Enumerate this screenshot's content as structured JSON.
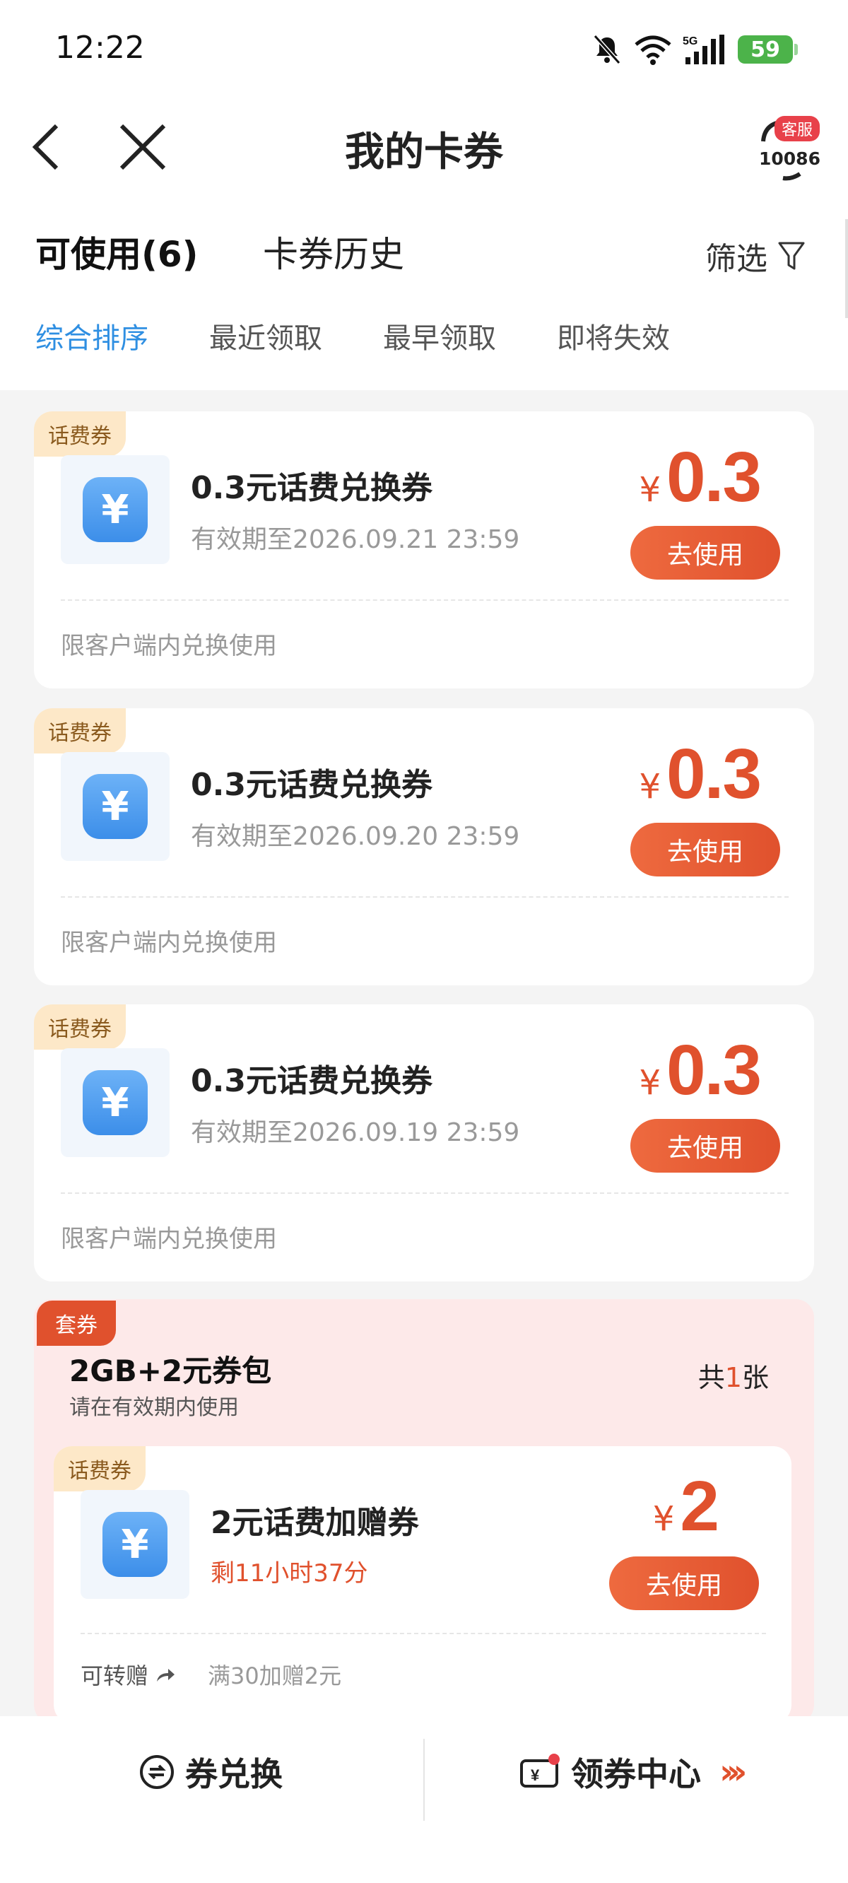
{
  "status_bar": {
    "time": "12:22",
    "network": "5G",
    "battery": "59"
  },
  "nav": {
    "title": "我的卡券",
    "service_badge": "客服",
    "service_number": "10086"
  },
  "tabs": {
    "available": "可使用(6)",
    "history": "卡券历史",
    "filter": "筛选"
  },
  "sorts": [
    "综合排序",
    "最近领取",
    "最早领取",
    "即将失效"
  ],
  "coupons": [
    {
      "tag": "话费券",
      "name": "0.3元话费兑换券",
      "expiry": "有效期至2026.09.21 23:59",
      "currency": "¥",
      "amount": "0.3",
      "button": "去使用",
      "note": "限客户端内兑换使用"
    },
    {
      "tag": "话费券",
      "name": "0.3元话费兑换券",
      "expiry": "有效期至2026.09.20 23:59",
      "currency": "¥",
      "amount": "0.3",
      "button": "去使用",
      "note": "限客户端内兑换使用"
    },
    {
      "tag": "话费券",
      "name": "0.3元话费兑换券",
      "expiry": "有效期至2026.09.19 23:59",
      "currency": "¥",
      "amount": "0.3",
      "button": "去使用",
      "note": "限客户端内兑换使用"
    }
  ],
  "package": {
    "tag": "套券",
    "title": "2GB+2元券包",
    "subtitle": "请在有效期内使用",
    "count_prefix": "共",
    "count": "1",
    "count_suffix": "张",
    "coupon": {
      "tag": "话费券",
      "name": "2元话费加赠券",
      "countdown": "剩11小时37分",
      "currency": "¥",
      "amount": "2",
      "button": "去使用",
      "transfer": "可转赠",
      "rule": "满30加赠2元"
    }
  },
  "bottom_bar": {
    "exchange": "券兑换",
    "center": "领券中心"
  },
  "colors": {
    "accent": "#e0512d",
    "active_sort": "#2f8fe2",
    "tag_bg": "#fde8c8",
    "package_bg": "#fde9e9"
  }
}
